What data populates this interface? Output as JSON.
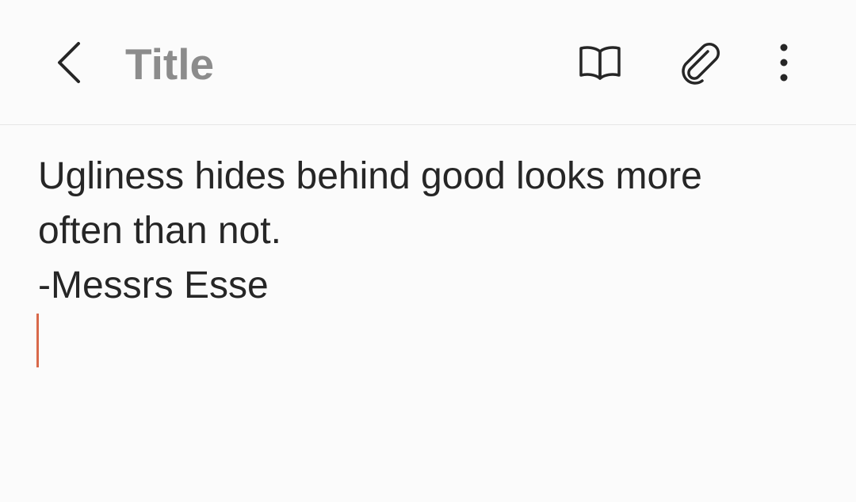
{
  "toolbar": {
    "back_icon": "chevron-left-icon",
    "title_placeholder": "Title",
    "reader_icon": "open-book-icon",
    "attach_icon": "paperclip-icon",
    "more_icon": "more-vertical-icon"
  },
  "note": {
    "lines": [
      "Ugliness hides behind good looks more",
      "often than not.",
      "-Messrs Esse"
    ]
  },
  "colors": {
    "background": "#fbfbfb",
    "title_placeholder": "#8c8c8c",
    "body_text": "#262626",
    "cursor": "#d9694a",
    "divider": "#e6e6e6"
  }
}
